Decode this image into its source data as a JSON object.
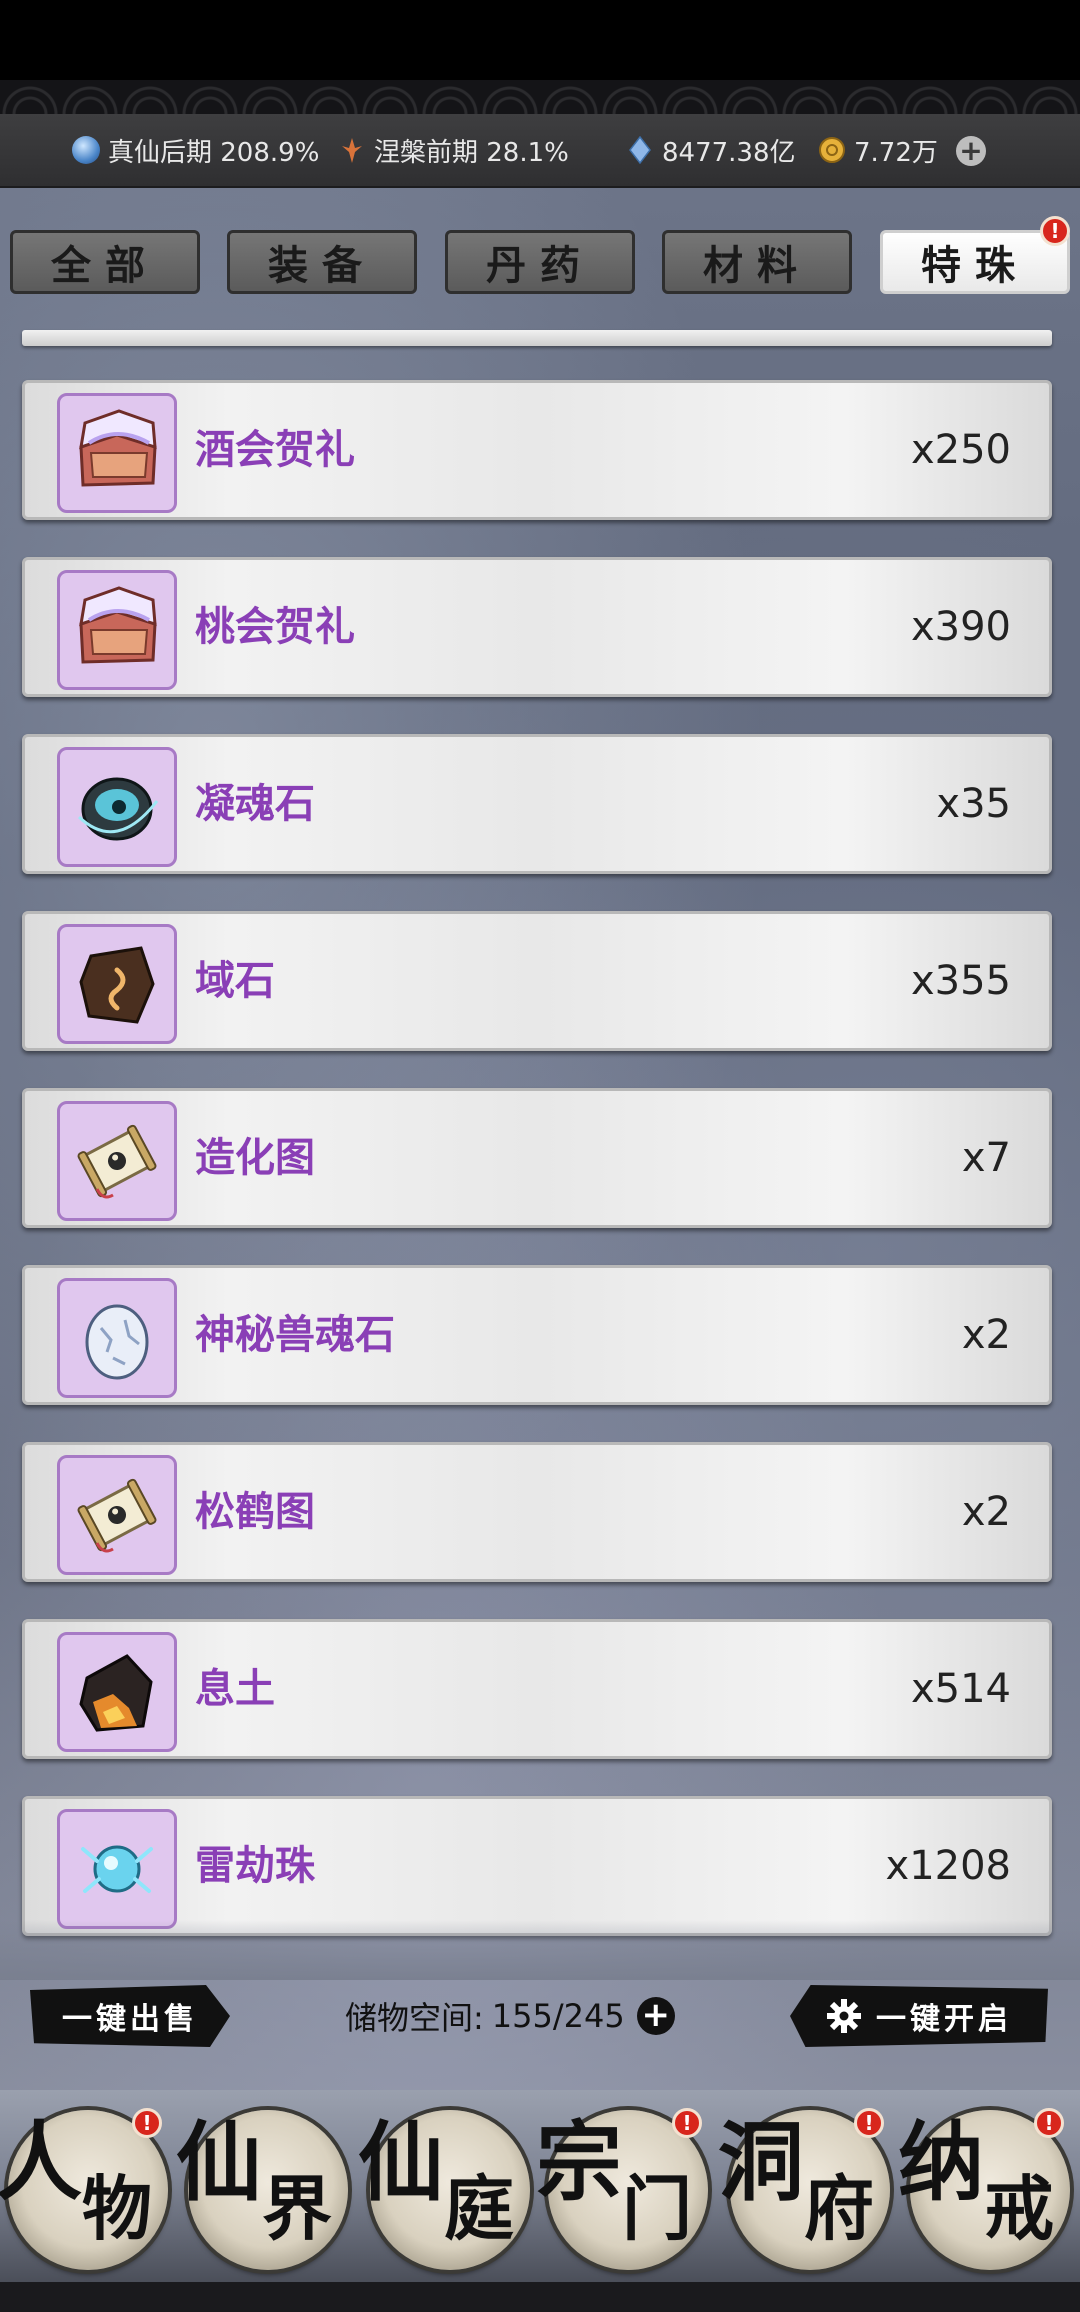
{
  "resources": {
    "realm": "真仙后期 208.9%",
    "nirvana": "涅槃前期 28.1%",
    "crystals": "8477.38亿",
    "coins": "7.72万",
    "add": "+"
  },
  "tabs": [
    {
      "label": "全部",
      "active": false
    },
    {
      "label": "装备",
      "active": false
    },
    {
      "label": "丹药",
      "active": false
    },
    {
      "label": "材料",
      "active": false
    },
    {
      "label": "特珠",
      "active": true
    }
  ],
  "badge_mark": "!",
  "items": [
    {
      "name": "酒会贺礼",
      "count": "x250",
      "icon": "gift-chest-icon"
    },
    {
      "name": "桃会贺礼",
      "count": "x390",
      "icon": "gift-chest-icon"
    },
    {
      "name": "凝魂石",
      "count": "x35",
      "icon": "soul-stone-icon"
    },
    {
      "name": "域石",
      "count": "x355",
      "icon": "domain-stone-icon"
    },
    {
      "name": "造化图",
      "count": "x7",
      "icon": "scroll-icon"
    },
    {
      "name": "神秘兽魂石",
      "count": "x2",
      "icon": "egg-stone-icon"
    },
    {
      "name": "松鹤图",
      "count": "x2",
      "icon": "scroll-icon"
    },
    {
      "name": "息土",
      "count": "x514",
      "icon": "ore-icon"
    },
    {
      "name": "雷劫珠",
      "count": "x1208",
      "icon": "thunder-orb-icon"
    }
  ],
  "actions": {
    "sell_all": "一键出售",
    "storage_label": "储物空间:",
    "storage_value": "155/245",
    "open_all": "一键开启"
  },
  "nav": [
    {
      "c1": "人",
      "c2": "物",
      "badge": true
    },
    {
      "c1": "仙",
      "c2": "界",
      "badge": false
    },
    {
      "c1": "仙",
      "c2": "庭",
      "badge": false
    },
    {
      "c1": "宗",
      "c2": "门",
      "badge": true
    },
    {
      "c1": "洞",
      "c2": "府",
      "badge": true
    },
    {
      "c1": "纳",
      "c2": "戒",
      "badge": true
    }
  ]
}
